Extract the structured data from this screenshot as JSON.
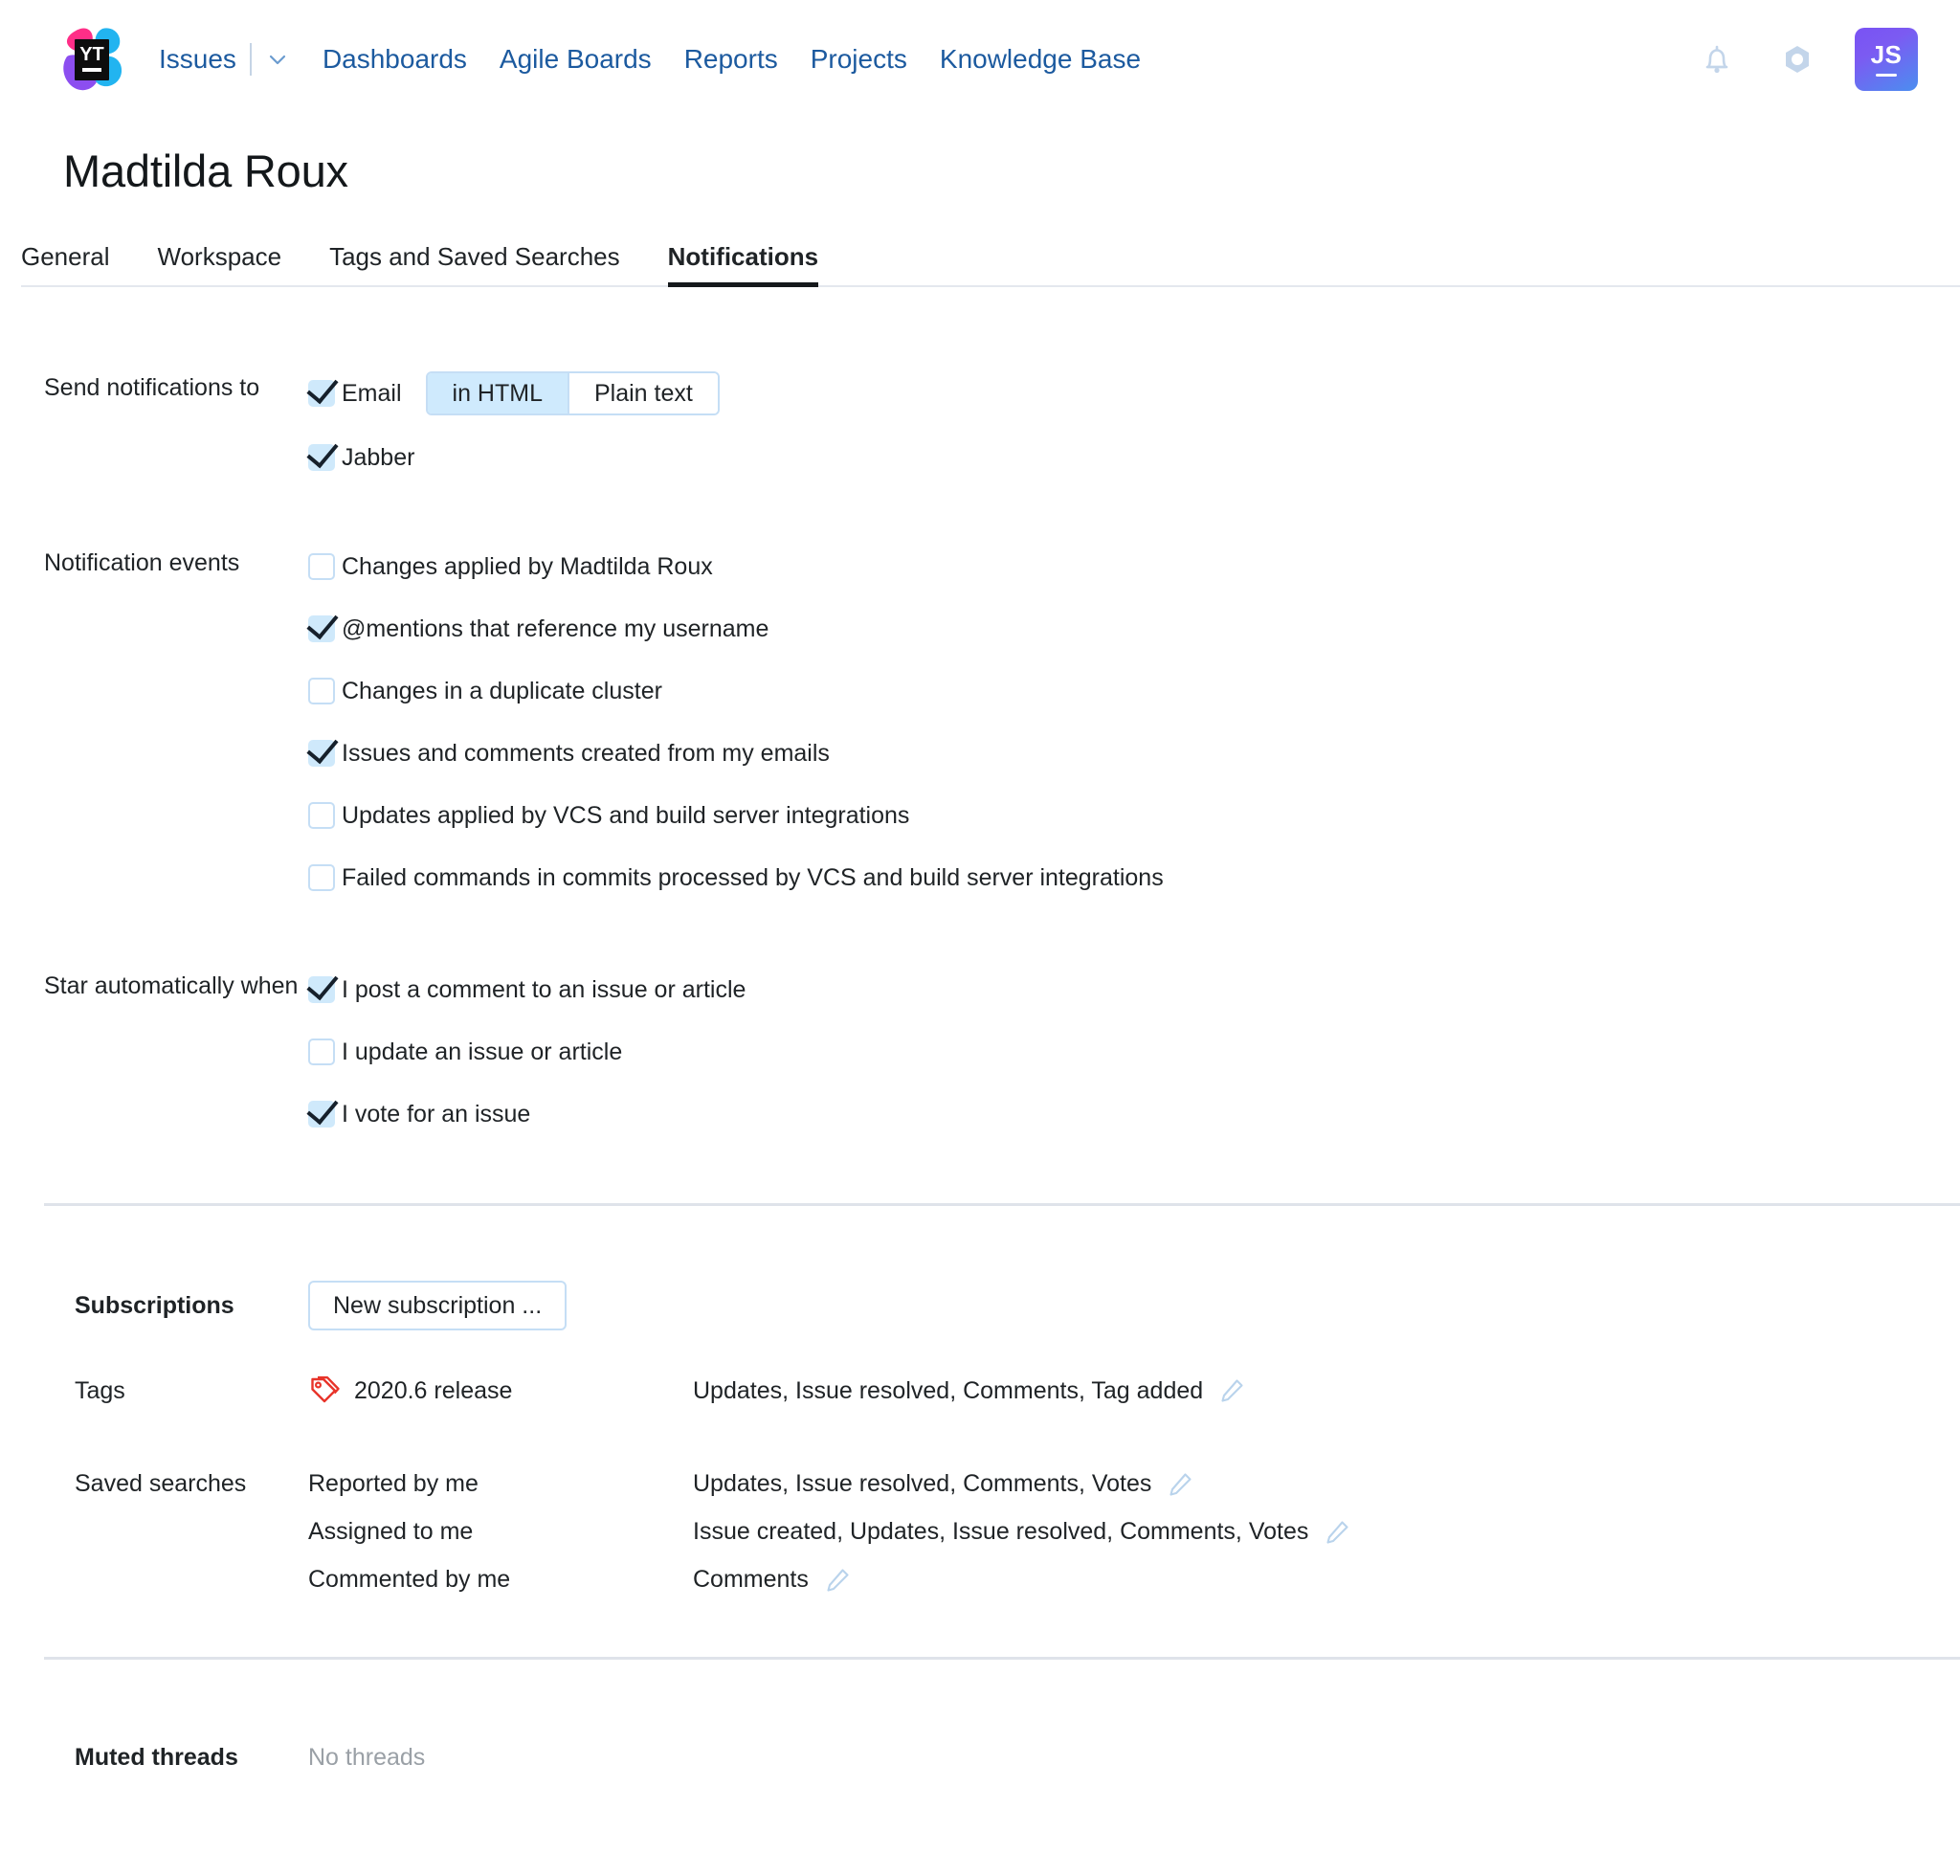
{
  "header": {
    "logo_text_top": "YT",
    "logo_alt": "youtrack-logo",
    "nav": [
      {
        "label": "Issues",
        "name": "nav-issues",
        "has_dropdown": true
      },
      {
        "label": "Dashboards",
        "name": "nav-dashboards",
        "has_dropdown": false
      },
      {
        "label": "Agile Boards",
        "name": "nav-agile-boards",
        "has_dropdown": false
      },
      {
        "label": "Reports",
        "name": "nav-reports",
        "has_dropdown": false
      },
      {
        "label": "Projects",
        "name": "nav-projects",
        "has_dropdown": false
      },
      {
        "label": "Knowledge Base",
        "name": "nav-knowledge-base",
        "has_dropdown": false
      }
    ],
    "bell_icon": "bell-icon",
    "settings_icon": "nut-settings-icon",
    "avatar_initials": "JS",
    "link_color": "#1c5a9f",
    "avatar_gradient_from": "#7a52f4",
    "avatar_gradient_to": "#4b8ef0"
  },
  "page": {
    "title": "Madtilda Roux",
    "tabs": [
      {
        "label": "General",
        "active": false
      },
      {
        "label": "Workspace",
        "active": false
      },
      {
        "label": "Tags and Saved Searches",
        "active": false
      },
      {
        "label": "Notifications",
        "active": true
      }
    ]
  },
  "send_notifications": {
    "label": "Send notifications to",
    "email": {
      "label": "Email",
      "checked": true
    },
    "format_options": [
      {
        "label": "in HTML",
        "selected": true
      },
      {
        "label": "Plain text",
        "selected": false
      }
    ],
    "jabber": {
      "label": "Jabber",
      "checked": true
    }
  },
  "notification_events": {
    "label": "Notification events",
    "items": [
      {
        "label": "Changes applied by Madtilda Roux",
        "checked": false
      },
      {
        "label": "@mentions that reference my username",
        "checked": true
      },
      {
        "label": "Changes in a duplicate cluster",
        "checked": false
      },
      {
        "label": "Issues and comments created from my emails",
        "checked": true
      },
      {
        "label": "Updates applied by VCS and build server integrations",
        "checked": false
      },
      {
        "label": "Failed commands in commits processed by VCS and build server integrations",
        "checked": false
      }
    ]
  },
  "star_automatically": {
    "label": "Star automatically when",
    "items": [
      {
        "label": "I post a comment to an issue or article",
        "checked": true
      },
      {
        "label": "I update an issue or article",
        "checked": false
      },
      {
        "label": "I vote for an issue",
        "checked": true
      }
    ]
  },
  "subscriptions": {
    "label": "Subscriptions",
    "new_subscription_button": "New subscription ...",
    "tags_label": "Tags",
    "tags": [
      {
        "name": "2020.6 release",
        "icon": "tag-icon",
        "icon_color": "#e8342a",
        "events": "Updates, Issue resolved, Comments, Tag added"
      }
    ],
    "saved_searches_label": "Saved searches",
    "saved_searches": [
      {
        "name": "Reported by me",
        "events": "Updates, Issue resolved, Comments, Votes"
      },
      {
        "name": "Assigned to me",
        "events": "Issue created, Updates, Issue resolved, Comments, Votes"
      },
      {
        "name": "Commented by me",
        "events": "Comments"
      }
    ],
    "edit_icon": "pencil-edit-icon"
  },
  "muted_threads": {
    "label": "Muted threads",
    "value": "No threads"
  }
}
